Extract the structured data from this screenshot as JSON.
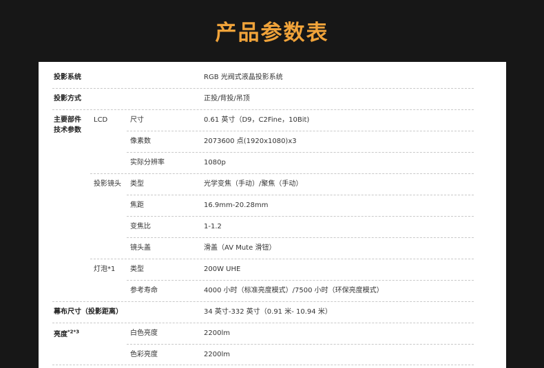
{
  "header": {
    "title": "产品参数表"
  },
  "spec_table": {
    "projection_system": {
      "label": "投影系统",
      "value": "RGB 光阀式液晶投影系统"
    },
    "projection_mode": {
      "label": "投影方式",
      "value": "正投/背投/吊顶"
    },
    "main_components": {
      "label_line1": "主要部件",
      "label_line2": "技术参数",
      "lcd": {
        "label": "LCD",
        "size_label": "尺寸",
        "size_value": "0.61 英寸（D9，C2Fine，10Bit)",
        "pixels_label": "像素数",
        "pixels_value": "2073600 点(1920x1080)x3",
        "resolution_label": "实际分辨率",
        "resolution_value": "1080p"
      },
      "lens": {
        "label": "投影镜头",
        "type_label": "类型",
        "type_value": "光学变焦（手动）/聚焦（手动）",
        "focal_label": "焦距",
        "focal_value": "16.9mm-20.28mm",
        "zoom_label": "变焦比",
        "zoom_value": "1-1.2",
        "cover_label": "镜头盖",
        "cover_value": "滑盖（AV Mute 滑钮）"
      },
      "lamp": {
        "label": "灯泡",
        "footnote": "*1",
        "type_label": "类型",
        "type_value": "200W UHE",
        "life_label": "参考寿命",
        "life_value": "4000 小时（标准亮度模式）/7500 小时（环保亮度模式）"
      }
    },
    "screen_size": {
      "label": "幕布尺寸（投影距离）",
      "value": "34 英寸-332 英寸（0.91 米- 10.94 米）"
    },
    "brightness": {
      "label": "亮度",
      "footnote": "*2*3",
      "white_label": "白色亮度",
      "white_value": "2200lm",
      "color_label": "色彩亮度",
      "color_value": "2200lm"
    }
  }
}
